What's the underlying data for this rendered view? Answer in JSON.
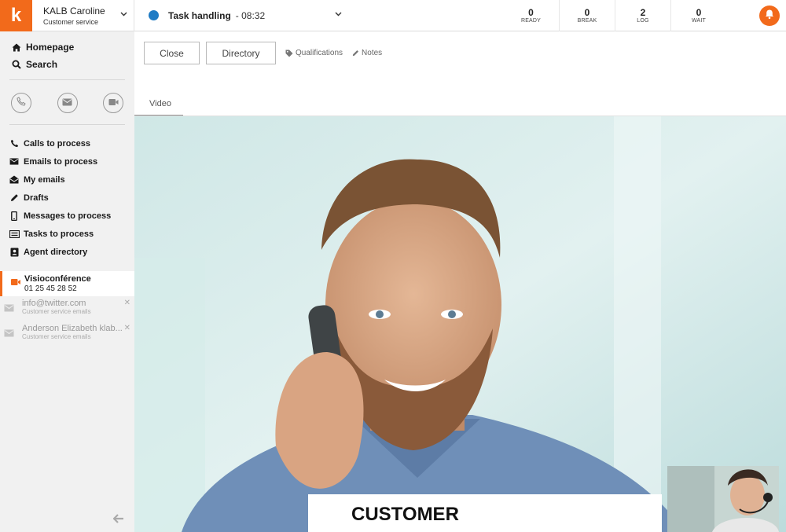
{
  "app": {
    "logo_letter": "k",
    "accent_color": "#f26a1b",
    "user_name": "KALB Caroline",
    "user_team": "Customer service"
  },
  "task": {
    "title": "Task handling",
    "timer": "- 08:32",
    "status_color": "#1f7bc4"
  },
  "counters": [
    {
      "value": "0",
      "label": "READY"
    },
    {
      "value": "0",
      "label": "BREAK"
    },
    {
      "value": "2",
      "label": "LOG"
    },
    {
      "value": "0",
      "label": "WAIT"
    }
  ],
  "sidebar": {
    "top_items": [
      {
        "label": "Homepage",
        "icon": "home-icon"
      },
      {
        "label": "Search",
        "icon": "search-icon"
      }
    ],
    "round_buttons": [
      "phone-icon",
      "email-icon",
      "video-icon"
    ],
    "items": [
      {
        "label": "Calls to process",
        "icon": "phone-icon"
      },
      {
        "label": "Emails to process",
        "icon": "envelope-icon"
      },
      {
        "label": "My emails",
        "icon": "open-envelope-icon"
      },
      {
        "label": "Drafts",
        "icon": "pencil-icon"
      },
      {
        "label": "Messages to process",
        "icon": "mobile-icon"
      },
      {
        "label": "Tasks to process",
        "icon": "tasks-icon"
      },
      {
        "label": "Agent directory",
        "icon": "contact-book-icon"
      }
    ],
    "active_session": {
      "title": "Visioconférence",
      "phone": "01 25 45 28 52"
    },
    "mail_sessions": [
      {
        "address": "info@twitter.com",
        "queue": "Customer service emails"
      },
      {
        "address": "Anderson Elizabeth klab...",
        "queue": "Customer service emails"
      }
    ]
  },
  "toolbar": {
    "close_label": "Close",
    "directory_label": "Directory",
    "qualifications_label": "Qualifications",
    "notes_label": "Notes"
  },
  "tabs": [
    {
      "label": "Video",
      "active": true
    }
  ],
  "video": {
    "caption": "CUSTOMER"
  }
}
